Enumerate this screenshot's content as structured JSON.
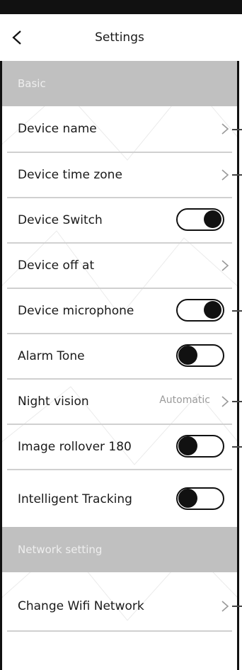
{
  "header": {
    "title": "Settings"
  },
  "sections": {
    "basic": "Basic",
    "network": "Network setting"
  },
  "basic_rows": [
    {
      "label": "Device name",
      "type": "link"
    },
    {
      "label": "Device time zone",
      "type": "link"
    },
    {
      "label": "Device Switch",
      "type": "toggle",
      "on": true
    },
    {
      "label": "Device off at",
      "type": "link"
    },
    {
      "label": "Device microphone",
      "type": "toggle",
      "on": true
    },
    {
      "label": "Alarm Tone",
      "type": "toggle",
      "on": false
    },
    {
      "label": "Night vision",
      "type": "link",
      "value": "Automatic"
    },
    {
      "label": "Image rollover 180",
      "type": "toggle",
      "on": false
    },
    {
      "label": "Intelligent Tracking",
      "type": "toggle",
      "on": false
    }
  ],
  "network_rows": [
    {
      "label": "Change Wifi Network",
      "type": "link"
    }
  ],
  "colors": {
    "section_bg": "#c0c0c0",
    "toggle_knob": "#111111"
  }
}
